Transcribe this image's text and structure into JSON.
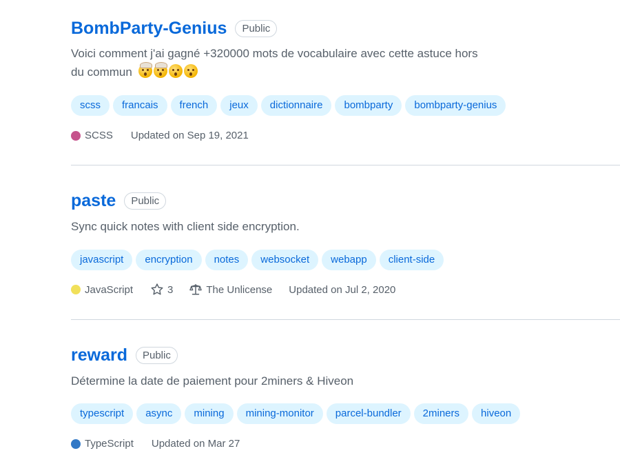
{
  "repos": [
    {
      "name": "BombParty-Genius",
      "visibility": "Public",
      "description": "Voici comment j'ai gagné +320000 mots de vocabulaire avec cette astuce hors du commun",
      "emojis": [
        "exploding-head-icon",
        "exploding-head-icon",
        "astonished-face-icon",
        "astonished-face-icon"
      ],
      "topics": [
        "scss",
        "francais",
        "french",
        "jeux",
        "dictionnaire",
        "bombparty",
        "bombparty-genius"
      ],
      "language": "SCSS",
      "language_color": "#c6538c",
      "updated": "Updated on Sep 19, 2021"
    },
    {
      "name": "paste",
      "visibility": "Public",
      "description": "Sync quick notes with client side encryption.",
      "topics": [
        "javascript",
        "encryption",
        "notes",
        "websocket",
        "webapp",
        "client-side"
      ],
      "language": "JavaScript",
      "language_color": "#f1e05a",
      "stars": "3",
      "license": "The Unlicense",
      "updated": "Updated on Jul 2, 2020"
    },
    {
      "name": "reward",
      "visibility": "Public",
      "description": "Détermine la date de paiement pour 2miners & Hiveon",
      "topics": [
        "typescript",
        "async",
        "mining",
        "mining-monitor",
        "parcel-bundler",
        "2miners",
        "hiveon"
      ],
      "language": "TypeScript",
      "language_color": "#3178c6",
      "updated": "Updated on Mar 27"
    }
  ],
  "colors": {
    "link": "#0969da",
    "topic_bg": "#ddf4ff",
    "muted": "#57606a",
    "border": "#d0d7de"
  }
}
